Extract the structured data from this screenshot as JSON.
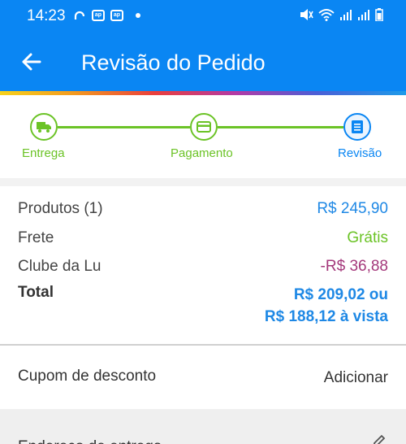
{
  "status_bar": {
    "time": "14:23",
    "left_icons": [
      "sync-icon",
      "app-icon",
      "app-icon",
      "dot-icon"
    ],
    "right_icons": [
      "mute-icon",
      "wifi-icon",
      "signal-icon",
      "signal-icon",
      "battery-icon"
    ]
  },
  "app_bar": {
    "title": "Revisão do Pedido",
    "back_icon": "arrow-left-icon"
  },
  "colors": {
    "primary": "#0a86f3",
    "green": "#6bc326",
    "value_blue": "#1e88e5",
    "discount_purple": "#a4387b"
  },
  "stepper": {
    "steps": [
      {
        "label": "Entrega",
        "icon": "truck-icon",
        "state": "done"
      },
      {
        "label": "Pagamento",
        "icon": "credit-card-icon",
        "state": "done"
      },
      {
        "label": "Revisão",
        "icon": "document-icon",
        "state": "current"
      }
    ]
  },
  "summary": {
    "products_label": "Produtos (1)",
    "products_value": "R$ 245,90",
    "shipping_label": "Frete",
    "shipping_value": "Grátis",
    "club_label": "Clube da Lu",
    "club_value": "-R$ 36,88",
    "total_label": "Total",
    "total_value_line1": "R$ 209,02 ou",
    "total_value_line2": "R$ 188,12 à vista"
  },
  "coupon": {
    "label": "Cupom de desconto",
    "action": "Adicionar"
  },
  "next_section": {
    "partial_text": "Endereço de entrega",
    "icon": "edit-icon"
  }
}
